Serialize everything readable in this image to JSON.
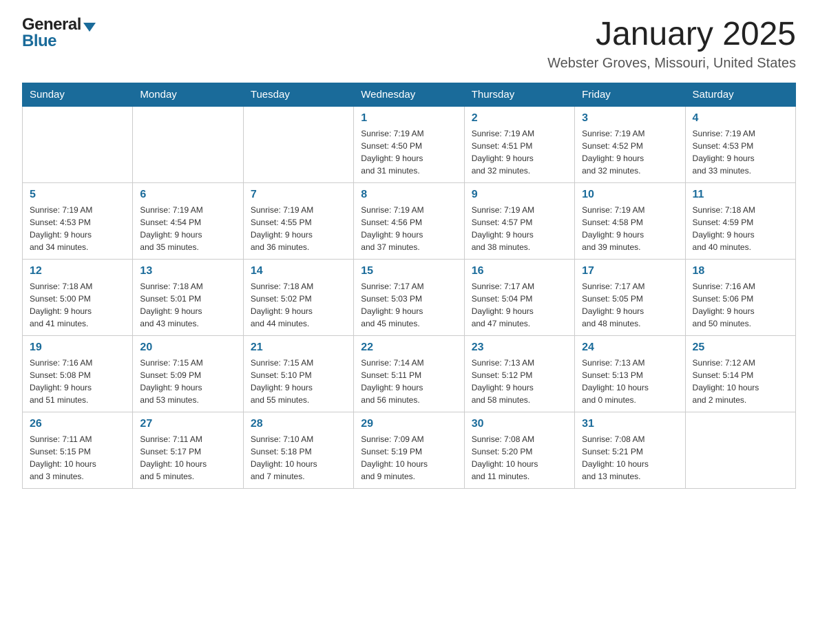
{
  "header": {
    "logo_general": "General",
    "logo_blue": "Blue",
    "title": "January 2025",
    "subtitle": "Webster Groves, Missouri, United States"
  },
  "calendar": {
    "days_of_week": [
      "Sunday",
      "Monday",
      "Tuesday",
      "Wednesday",
      "Thursday",
      "Friday",
      "Saturday"
    ],
    "weeks": [
      [
        {
          "day": "",
          "info": ""
        },
        {
          "day": "",
          "info": ""
        },
        {
          "day": "",
          "info": ""
        },
        {
          "day": "1",
          "info": "Sunrise: 7:19 AM\nSunset: 4:50 PM\nDaylight: 9 hours\nand 31 minutes."
        },
        {
          "day": "2",
          "info": "Sunrise: 7:19 AM\nSunset: 4:51 PM\nDaylight: 9 hours\nand 32 minutes."
        },
        {
          "day": "3",
          "info": "Sunrise: 7:19 AM\nSunset: 4:52 PM\nDaylight: 9 hours\nand 32 minutes."
        },
        {
          "day": "4",
          "info": "Sunrise: 7:19 AM\nSunset: 4:53 PM\nDaylight: 9 hours\nand 33 minutes."
        }
      ],
      [
        {
          "day": "5",
          "info": "Sunrise: 7:19 AM\nSunset: 4:53 PM\nDaylight: 9 hours\nand 34 minutes."
        },
        {
          "day": "6",
          "info": "Sunrise: 7:19 AM\nSunset: 4:54 PM\nDaylight: 9 hours\nand 35 minutes."
        },
        {
          "day": "7",
          "info": "Sunrise: 7:19 AM\nSunset: 4:55 PM\nDaylight: 9 hours\nand 36 minutes."
        },
        {
          "day": "8",
          "info": "Sunrise: 7:19 AM\nSunset: 4:56 PM\nDaylight: 9 hours\nand 37 minutes."
        },
        {
          "day": "9",
          "info": "Sunrise: 7:19 AM\nSunset: 4:57 PM\nDaylight: 9 hours\nand 38 minutes."
        },
        {
          "day": "10",
          "info": "Sunrise: 7:19 AM\nSunset: 4:58 PM\nDaylight: 9 hours\nand 39 minutes."
        },
        {
          "day": "11",
          "info": "Sunrise: 7:18 AM\nSunset: 4:59 PM\nDaylight: 9 hours\nand 40 minutes."
        }
      ],
      [
        {
          "day": "12",
          "info": "Sunrise: 7:18 AM\nSunset: 5:00 PM\nDaylight: 9 hours\nand 41 minutes."
        },
        {
          "day": "13",
          "info": "Sunrise: 7:18 AM\nSunset: 5:01 PM\nDaylight: 9 hours\nand 43 minutes."
        },
        {
          "day": "14",
          "info": "Sunrise: 7:18 AM\nSunset: 5:02 PM\nDaylight: 9 hours\nand 44 minutes."
        },
        {
          "day": "15",
          "info": "Sunrise: 7:17 AM\nSunset: 5:03 PM\nDaylight: 9 hours\nand 45 minutes."
        },
        {
          "day": "16",
          "info": "Sunrise: 7:17 AM\nSunset: 5:04 PM\nDaylight: 9 hours\nand 47 minutes."
        },
        {
          "day": "17",
          "info": "Sunrise: 7:17 AM\nSunset: 5:05 PM\nDaylight: 9 hours\nand 48 minutes."
        },
        {
          "day": "18",
          "info": "Sunrise: 7:16 AM\nSunset: 5:06 PM\nDaylight: 9 hours\nand 50 minutes."
        }
      ],
      [
        {
          "day": "19",
          "info": "Sunrise: 7:16 AM\nSunset: 5:08 PM\nDaylight: 9 hours\nand 51 minutes."
        },
        {
          "day": "20",
          "info": "Sunrise: 7:15 AM\nSunset: 5:09 PM\nDaylight: 9 hours\nand 53 minutes."
        },
        {
          "day": "21",
          "info": "Sunrise: 7:15 AM\nSunset: 5:10 PM\nDaylight: 9 hours\nand 55 minutes."
        },
        {
          "day": "22",
          "info": "Sunrise: 7:14 AM\nSunset: 5:11 PM\nDaylight: 9 hours\nand 56 minutes."
        },
        {
          "day": "23",
          "info": "Sunrise: 7:13 AM\nSunset: 5:12 PM\nDaylight: 9 hours\nand 58 minutes."
        },
        {
          "day": "24",
          "info": "Sunrise: 7:13 AM\nSunset: 5:13 PM\nDaylight: 10 hours\nand 0 minutes."
        },
        {
          "day": "25",
          "info": "Sunrise: 7:12 AM\nSunset: 5:14 PM\nDaylight: 10 hours\nand 2 minutes."
        }
      ],
      [
        {
          "day": "26",
          "info": "Sunrise: 7:11 AM\nSunset: 5:15 PM\nDaylight: 10 hours\nand 3 minutes."
        },
        {
          "day": "27",
          "info": "Sunrise: 7:11 AM\nSunset: 5:17 PM\nDaylight: 10 hours\nand 5 minutes."
        },
        {
          "day": "28",
          "info": "Sunrise: 7:10 AM\nSunset: 5:18 PM\nDaylight: 10 hours\nand 7 minutes."
        },
        {
          "day": "29",
          "info": "Sunrise: 7:09 AM\nSunset: 5:19 PM\nDaylight: 10 hours\nand 9 minutes."
        },
        {
          "day": "30",
          "info": "Sunrise: 7:08 AM\nSunset: 5:20 PM\nDaylight: 10 hours\nand 11 minutes."
        },
        {
          "day": "31",
          "info": "Sunrise: 7:08 AM\nSunset: 5:21 PM\nDaylight: 10 hours\nand 13 minutes."
        },
        {
          "day": "",
          "info": ""
        }
      ]
    ]
  }
}
